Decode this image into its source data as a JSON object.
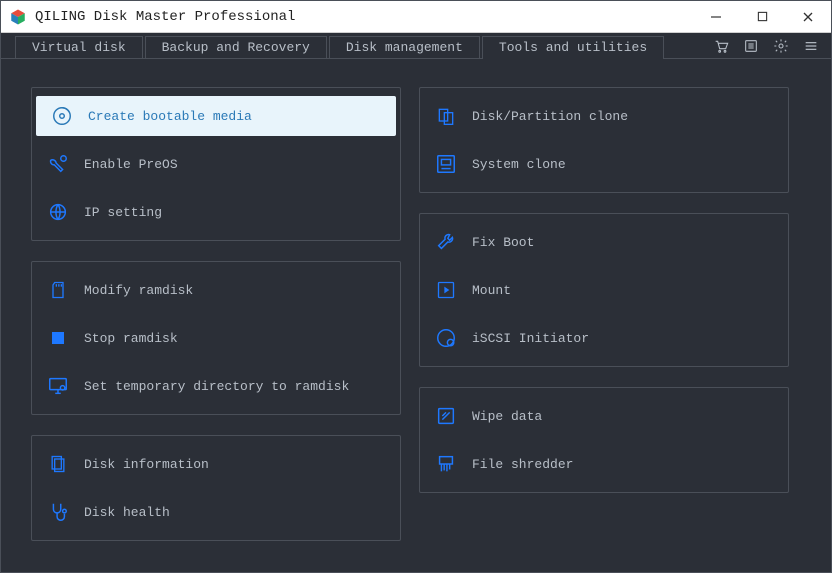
{
  "app": {
    "title": "QILING Disk Master Professional"
  },
  "tabs": {
    "virtual": "Virtual disk",
    "backup": "Backup and Recovery",
    "disk": "Disk management",
    "tools": "Tools and utilities"
  },
  "left": {
    "g1": {
      "create_bootable": "Create bootable media",
      "enable_preos": "Enable PreOS",
      "ip_setting": "IP setting"
    },
    "g2": {
      "modify_ramdisk": "Modify ramdisk",
      "stop_ramdisk": "Stop ramdisk",
      "temp_dir": "Set temporary directory to ramdisk"
    },
    "g3": {
      "disk_info": "Disk information",
      "disk_health": "Disk health"
    }
  },
  "right": {
    "g1": {
      "partition_clone": "Disk/Partition clone",
      "system_clone": "System clone"
    },
    "g2": {
      "fix_boot": "Fix Boot",
      "mount": "Mount",
      "iscsi": "iSCSI Initiator"
    },
    "g3": {
      "wipe": "Wipe data",
      "shredder": "File shredder"
    }
  }
}
